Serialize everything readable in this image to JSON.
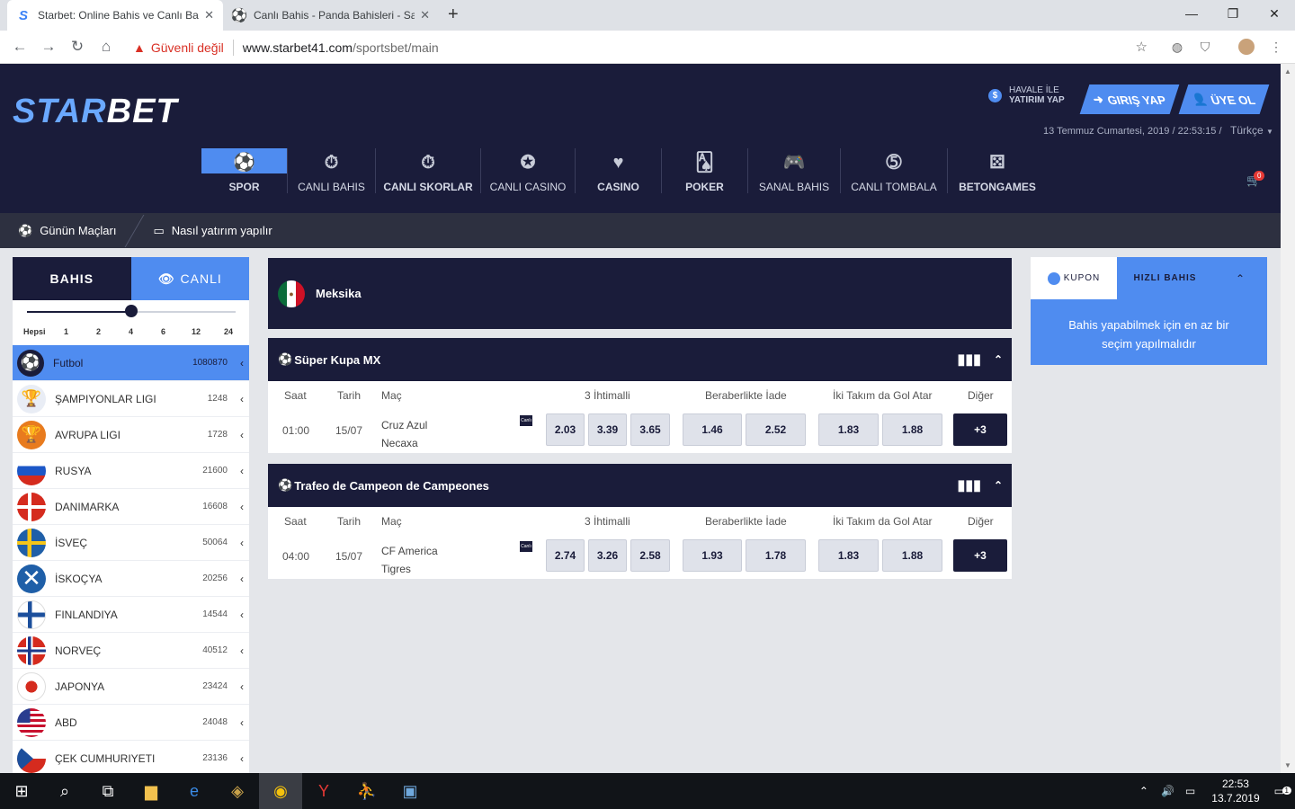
{
  "browser": {
    "tabs": [
      {
        "title": "Starbet: Online Bahis ve Canlı Ba",
        "active": true
      },
      {
        "title": "Canlı Bahis - Panda Bahisleri - Sa",
        "active": false
      }
    ],
    "security_warning": "Güvenli değil",
    "url_host": "www.starbet41.com",
    "url_path": "/sportsbet/main"
  },
  "header": {
    "logo_a": "STAR",
    "logo_b": "BET",
    "havale_line1": "HAVALE İLE",
    "havale_line2": "YATIRIM YAP",
    "login_label": "GIRIŞ YAP",
    "signup_label": "ÜYE OL",
    "datetime": "13 Temmuz Cumartesi, 2019 / 22:53:15 /",
    "language": "Türkçe",
    "cart_count": "0"
  },
  "mainnav": [
    {
      "label": "SPOR",
      "icon": "soccer-ball-icon"
    },
    {
      "label": "CANLI BAHIS",
      "icon": "stopwatch-icon"
    },
    {
      "label": "CANLI SKORLAR",
      "icon": "stopwatch-icon"
    },
    {
      "label": "CANLI CASINO",
      "icon": "casino-chip-icon"
    },
    {
      "label": "CASINO",
      "icon": "heart-chip-icon"
    },
    {
      "label": "POKER",
      "icon": "cards-icon"
    },
    {
      "label": "SANAL BAHIS",
      "icon": "gamepad-icon"
    },
    {
      "label": "CANLI TOMBALA",
      "icon": "bingo-ball-icon"
    },
    {
      "label": "BETONGAMES",
      "icon": "dice-icon"
    }
  ],
  "subnav": {
    "todays_matches": "Günün Maçları",
    "how_to_deposit": "Nasıl yatırım yapılır"
  },
  "left": {
    "tab_bahis": "BAHIS",
    "tab_canli": "CANLI",
    "slider_labels": [
      "Hepsi",
      "1",
      "2",
      "4",
      "6",
      "12",
      "24"
    ],
    "slider_value": "4",
    "items": [
      {
        "name": "Futbol",
        "count": "1080870",
        "flag": "soccer"
      },
      {
        "name": "ŞAMPIYONLAR LIGI",
        "count": "1248",
        "flag": "ucl"
      },
      {
        "name": "AVRUPA LIGI",
        "count": "1728",
        "flag": "uel"
      },
      {
        "name": "RUSYA",
        "count": "21600",
        "flag": "ru"
      },
      {
        "name": "DANIMARKA",
        "count": "16608",
        "flag": "dk"
      },
      {
        "name": "İSVEÇ",
        "count": "50064",
        "flag": "se"
      },
      {
        "name": "İSKOÇYA",
        "count": "20256",
        "flag": "sc"
      },
      {
        "name": "FINLANDIYA",
        "count": "14544",
        "flag": "fi"
      },
      {
        "name": "NORVEÇ",
        "count": "40512",
        "flag": "no"
      },
      {
        "name": "JAPONYA",
        "count": "23424",
        "flag": "jp"
      },
      {
        "name": "ABD",
        "count": "24048",
        "flag": "us"
      },
      {
        "name": "ÇEK CUMHURIYETI",
        "count": "23136",
        "flag": "cz"
      }
    ]
  },
  "center": {
    "country": "Meksika",
    "columns": {
      "saat": "Saat",
      "tarih": "Tarih",
      "mac": "Maç",
      "three_way": "3 İhtimalli",
      "draw_no_bet": "Beraberlikte İade",
      "btts": "İki Takım da Gol Atar",
      "other": "Diğer"
    },
    "live_badge": "Canlı",
    "leagues": [
      {
        "title": "Süper Kupa MX",
        "time": "01:00",
        "date": "15/07",
        "home": "Cruz Azul",
        "away": "Necaxa",
        "odds3": [
          "2.03",
          "3.39",
          "3.65"
        ],
        "dnb": [
          "1.46",
          "2.52"
        ],
        "btts": [
          "1.83",
          "1.88"
        ],
        "more": "+3"
      },
      {
        "title": "Trafeo de Campeon de Campeones",
        "time": "04:00",
        "date": "15/07",
        "home": "CF America",
        "away": "Tigres",
        "odds3": [
          "2.74",
          "3.26",
          "2.58"
        ],
        "dnb": [
          "1.93",
          "1.78"
        ],
        "btts": [
          "1.83",
          "1.88"
        ],
        "more": "+3"
      }
    ]
  },
  "right": {
    "tab_kupon": "KUPON",
    "tab_hizli": "HIZLI BAHIS",
    "message": "Bahis yapabilmek için en az bir seçim yapılmalıdır"
  },
  "taskbar": {
    "time": "22:53",
    "date": "13.7.2019",
    "notifications": "1"
  },
  "colors": {
    "navy": "#1a1c3a",
    "accent": "#4f8cf0",
    "odd_bg": "#dfe2ea"
  }
}
